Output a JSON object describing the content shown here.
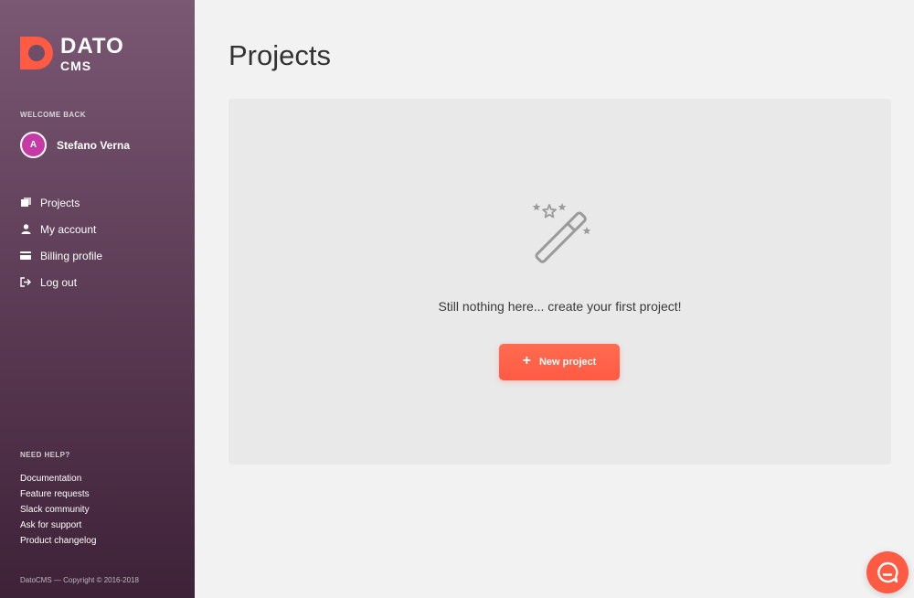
{
  "sidebar": {
    "logo": {
      "title": "DATO",
      "subtitle": "CMS",
      "brand_color": "#ff5a44"
    },
    "welcome_label": "WELCOME BACK",
    "user": {
      "initial": "A",
      "name": "Stefano Verna"
    },
    "nav": [
      {
        "label": "Projects",
        "icon": "projects-icon"
      },
      {
        "label": "My account",
        "icon": "user-icon"
      },
      {
        "label": "Billing profile",
        "icon": "credit-card-icon"
      },
      {
        "label": "Log out",
        "icon": "logout-icon"
      }
    ],
    "help_title": "NEED HELP?",
    "help_links": [
      "Documentation",
      "Feature requests",
      "Slack community",
      "Ask for support",
      "Product changelog"
    ],
    "copyright": "DatoCMS — Copyright © 2016-2018"
  },
  "main": {
    "title": "Projects",
    "empty_state": {
      "icon": "magic-wand-icon",
      "message": "Still nothing here... create your first project!",
      "button_label": "New project"
    }
  },
  "chat": {
    "icon": "chat-icon"
  },
  "colors": {
    "accent": "#ff5a44",
    "avatar": "#c63aa6",
    "sidebar_top": "#7a5874",
    "sidebar_bottom": "#3e2238"
  }
}
